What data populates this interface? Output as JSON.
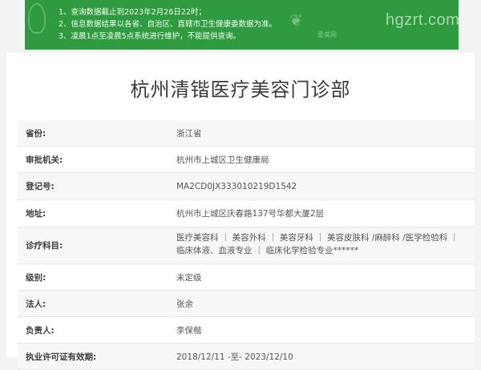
{
  "notice": {
    "lines": [
      "1、查询数据截止到2023年2月26日22时；",
      "2、信息数据结果以各省、自治区、直辖市卫生健康委数据为准。",
      "3、凌晨1点至凌晨5点系统进行维护，不能提供查询。"
    ],
    "watermark_text": "hgzrt.com",
    "watermark_small": "爱美网"
  },
  "clinic": {
    "title": "杭州清锴医疗美容门诊部"
  },
  "info_rows": [
    {
      "label": "省份:",
      "value": "浙江省"
    },
    {
      "label": "审批机关:",
      "value": "杭州市上城区卫生健康局"
    },
    {
      "label": "登记号:",
      "value": "MA2CD0JX333010219D1542"
    },
    {
      "label": "地址:",
      "value": "杭州市上城区庆春路137号华都大厦2层"
    },
    {
      "label": "诊疗科目:",
      "value": "医疗美容科 ｜ 美容外科 ｜ 美容牙科 ｜ 美容皮肤科 /麻醉科 /医学检验科 ｜ 临床体液、血液专业 ｜ 临床化学检验专业******"
    },
    {
      "label": "级别:",
      "value": "未定级"
    },
    {
      "label": "法人:",
      "value": "张余"
    },
    {
      "label": "负责人:",
      "value": "李保楷"
    },
    {
      "label": "执业许可证有效期:",
      "value": "2018/12/11 -至- 2023/12/10"
    }
  ],
  "colors": {
    "notice_bg": "#2f9a3f",
    "page_bg": "#f3f3f3"
  }
}
